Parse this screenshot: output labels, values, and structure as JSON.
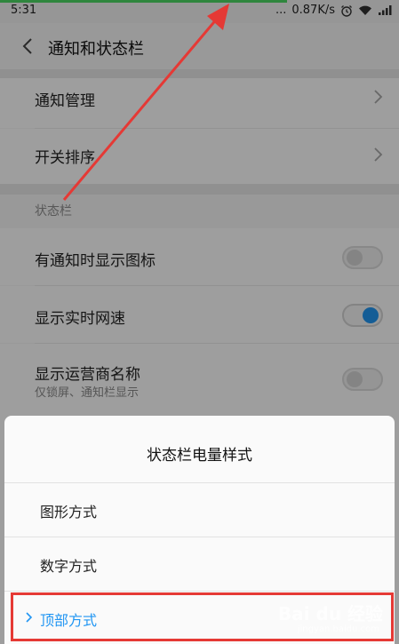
{
  "status_bar": {
    "time": "5:31",
    "dots": "...",
    "speed": "0.87K/s",
    "progress": 0.72
  },
  "header": {
    "title": "通知和状态栏"
  },
  "list": {
    "notification_management": "通知管理",
    "switch_order": "开关排序",
    "section_status_bar": "状态栏",
    "show_icon_on_notification": {
      "label": "有通知时显示图标",
      "on": false
    },
    "show_realtime_speed": {
      "label": "显示实时网速",
      "on": true
    },
    "show_carrier_name": {
      "label": "显示运营商名称",
      "sub": "仅锁屏、通知栏显示",
      "on": false
    }
  },
  "sheet": {
    "title": "状态栏电量样式",
    "options": [
      "图形方式",
      "数字方式",
      "顶部方式"
    ],
    "selected_index": 2
  },
  "watermark": {
    "brand": "Bai du 经验",
    "url": "jingyan.baidu.com"
  },
  "colors": {
    "accent": "#2196f3",
    "annotation_red": "#e53935",
    "progress_green": "#4cd964"
  }
}
